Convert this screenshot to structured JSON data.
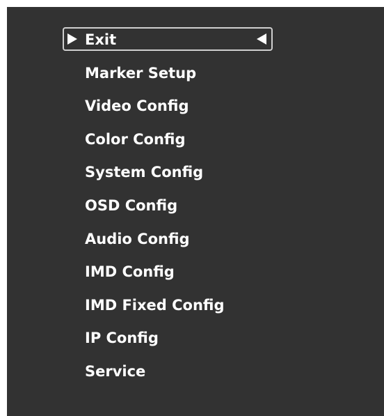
{
  "menu": {
    "items": [
      {
        "label": "Exit"
      },
      {
        "label": "Marker Setup"
      },
      {
        "label": "Video Config"
      },
      {
        "label": "Color Config"
      },
      {
        "label": "System Config"
      },
      {
        "label": "OSD Config"
      },
      {
        "label": "Audio Config"
      },
      {
        "label": "IMD Config"
      },
      {
        "label": "IMD Fixed Config"
      },
      {
        "label": "IP Config"
      },
      {
        "label": "Service"
      }
    ],
    "selected_index": 0
  },
  "icons": {
    "selector_left": "triangle-right-icon",
    "selector_right": "triangle-left-icon"
  },
  "colors": {
    "panel_background": "#323232",
    "text": "#ffffff",
    "selection_frame": "#cfcfcf"
  }
}
